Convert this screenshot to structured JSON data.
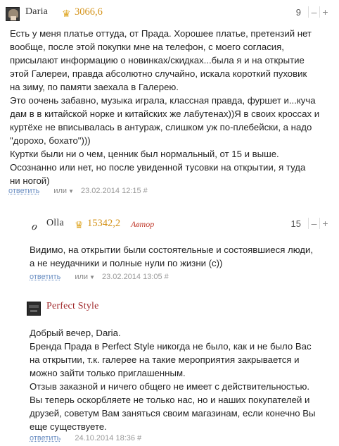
{
  "comments": [
    {
      "author": "Daria",
      "rating": "3066,6",
      "badge": "",
      "score": "9",
      "minus": "–",
      "plus": "+",
      "lines": [
        "Есть у меня платье оттуда, от Прада. Хорошее платье, претензий нет",
        "вообще, после этой покупки мне на телефон, с моего согласия,",
        "присылают информацию о новинках/скидках...была я и на открытие",
        "этой Галереи, правда абсолютно случайно, искала короткий пуховик",
        "на зиму, по памяти заехала в Галерею.",
        "Это оочень забавно, музыка играла, классная правда, фуршет и...куча",
        "дам в в китайской норке и китайских же лабутенах))Я в своих кроссах и",
        "куртёхе не вписывалась в антураж, слишком уж по-плебейски, а надо",
        "\"дорохо, бохато\")))",
        "Куртки были ни о чем, ценник был нормальный, от 15 и выше.",
        "Осознанно или нет, но после увиденной тусовки на открытии, я туда",
        "ни ногой)"
      ],
      "reply": "ответить",
      "or": "или",
      "date": "23.02.2014 12:15 #"
    },
    {
      "author": "Olla",
      "rating": "15342,2",
      "badge": "Автор",
      "score": "15",
      "minus": "–",
      "plus": "+",
      "lines": [
        "Видимо, на открытии были состоятельные и состоявшиеся люди,",
        "а не неудачники и полные нули по жизни (с))"
      ],
      "reply": "ответить",
      "or": "или",
      "date": "23.02.2014 13:05 #"
    },
    {
      "author": "Perfect Style",
      "rating": "",
      "badge": "",
      "lines": [
        "Добрый вечер, Daria.",
        "Бренда Прада в Perfect Style никогда не было, как и не было Вас",
        "на открытии, т.к. галерее на такие мероприятия закрывается и",
        "можно зайти только приглашенным.",
        "Отзыв заказной и ничего общего не имеет с действительностью.",
        "Вы теперь оскорбляете не только нас, но и наших покупателей и",
        "друзей, советум Вам заняться своим магазинам, если конечно Вы",
        "еще существуете."
      ],
      "reply": "ответить",
      "date": "24.10.2014 18:36 #"
    }
  ],
  "colors": {
    "rating": "#d4931a",
    "badge": "#c0392b",
    "link": "#6a8ec2"
  },
  "icons": {
    "crown": "crown-icon",
    "dropdown": "triangle-down-icon"
  }
}
